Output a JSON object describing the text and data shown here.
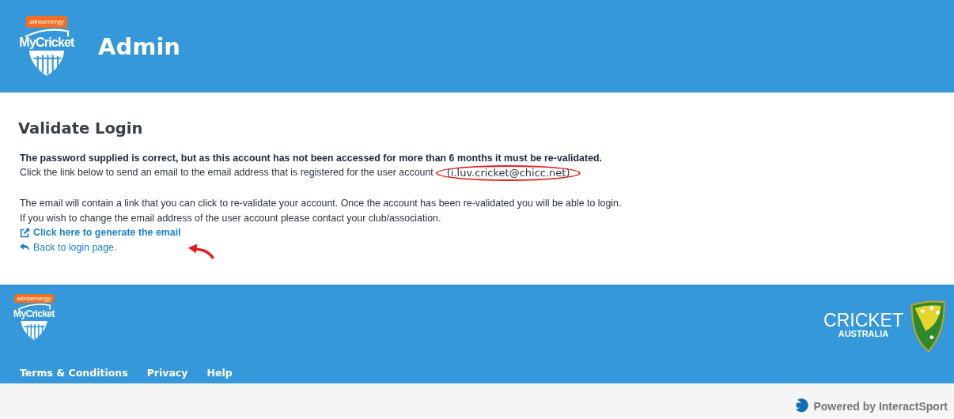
{
  "header": {
    "logo": {
      "sponsor": "alintaenergy",
      "name": "MyCricket"
    },
    "title": "Admin"
  },
  "content": {
    "heading": "Validate Login",
    "warning": "The password supplied is correct, but as this account has not been accessed for more than 6 months it must be re-validated.",
    "instruction": "Click the link below to send an email to the email address that is registered for the user account",
    "email": "(i.luv.cricket@chicc.net)",
    "info": [
      "The email will contain a link that you can click to re-validate your account. Once the account has been re-validated you will be able to login.",
      "If you wish to change the email address of the user account please contact your club/association."
    ],
    "links": [
      {
        "kind": "generate",
        "label": "Click here to generate the email"
      },
      {
        "kind": "back",
        "label": "Back to login page."
      }
    ]
  },
  "footer": {
    "logo": {
      "sponsor": "alintaenergy",
      "name": "MyCricket"
    },
    "links": [
      "Terms & Conditions",
      "Privacy",
      "Help"
    ],
    "partner": {
      "name": "CRICKET",
      "sub": "AUSTRALIA"
    }
  },
  "powered_by": "Powered by InteractSport"
}
